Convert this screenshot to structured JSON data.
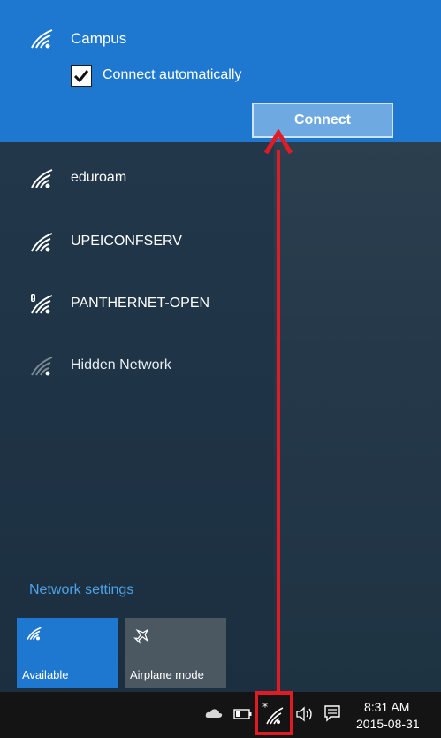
{
  "selected_network": {
    "name": "Campus",
    "connect_auto_label": "Connect automatically",
    "connect_auto_checked": true,
    "connect_button": "Connect"
  },
  "networks": [
    {
      "name": "eduroam",
      "icon": "wifi-icon"
    },
    {
      "name": "UPEICONFSERV",
      "icon": "wifi-icon"
    },
    {
      "name": "PANTHERNET-OPEN",
      "icon": "wifi-secured-warning-icon"
    },
    {
      "name": "Hidden Network",
      "icon": "wifi-icon"
    }
  ],
  "network_settings_link": "Network settings",
  "quick_actions": [
    {
      "label": "Available",
      "icon": "wifi-icon",
      "active": true
    },
    {
      "label": "Airplane mode",
      "icon": "airplane-icon",
      "active": false
    }
  ],
  "taskbar": {
    "time": "8:31 AM",
    "date": "2015-08-31",
    "tray_icons": [
      "onedrive-icon",
      "battery-icon",
      "wifi-icon",
      "volume-icon",
      "action-center-icon"
    ]
  },
  "colors": {
    "accent": "#1f78cf",
    "flyout_bg": "#1f3446",
    "link": "#4ea2e8",
    "annotation": "#e11b24"
  }
}
